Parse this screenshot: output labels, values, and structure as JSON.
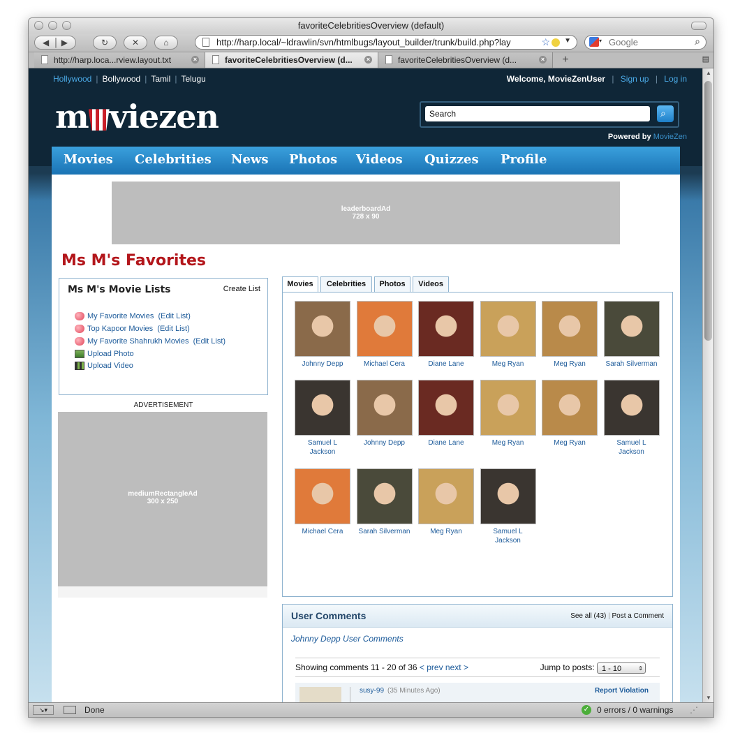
{
  "browser": {
    "title": "favoriteCelebritiesOverview (default)",
    "url": "http://harp.local/~ldrawlin/svn/htmlbugs/layout_builder/trunk/build.php?lay",
    "search_placeholder": "Google",
    "tabs": [
      {
        "label": "http://harp.loca...rview.layout.txt"
      },
      {
        "label": "favoriteCelebritiesOverview (d..."
      },
      {
        "label": "favoriteCelebritiesOverview (d..."
      }
    ],
    "status": "Done",
    "errors": "0 errors / 0 warnings"
  },
  "site": {
    "languages": [
      "Hollywood",
      "Bollywood",
      "Tamil",
      "Telugu"
    ],
    "welcome": "Welcome, MovieZenUser",
    "signup": "Sign up",
    "login": "Log in",
    "logo_left": "m",
    "logo_right": "viezen",
    "search_value": "Search",
    "powered_by": "Powered by",
    "powered_brand": "MovieZen",
    "nav": [
      "Movies",
      "Celebrities",
      "News",
      "Photos",
      "Videos",
      "Quizzes",
      "Profile"
    ]
  },
  "ads": {
    "leaderboard_name": "leaderboardAd",
    "leaderboard_size": "728 x 90",
    "advert_label": "ADVERTISEMENT",
    "medium_name": "mediumRectangleAd",
    "medium_size": "300 x 250"
  },
  "page": {
    "title": "Ms M's Favorites",
    "lists_heading": "Ms M's Movie Lists",
    "create_list": "Create List",
    "lists": [
      {
        "name": "My Favorite Movies",
        "edit": "(Edit List)"
      },
      {
        "name": "Top Kapoor Movies",
        "edit": "(Edit List)"
      },
      {
        "name": "My Favorite Shahrukh Movies",
        "edit": "(Edit List)"
      }
    ],
    "upload_photo": "Upload Photo",
    "upload_video": "Upload Video",
    "tabs": [
      "Movies",
      "Celebrities",
      "Photos",
      "Videos"
    ],
    "celebrities": [
      {
        "name": "Johnny Depp",
        "color": "#8a6a4a"
      },
      {
        "name": "Michael Cera",
        "color": "#e07a3a"
      },
      {
        "name": "Diane Lane",
        "color": "#6a2a22"
      },
      {
        "name": "Meg Ryan",
        "color": "#c9a15a"
      },
      {
        "name": "Meg Ryan",
        "color": "#b98a4a"
      },
      {
        "name": "Sarah Silverman",
        "color": "#4a4a3a"
      },
      {
        "name": "Samuel L Jackson",
        "color": "#3a3530"
      },
      {
        "name": "Johnny Depp",
        "color": "#8a6a4a"
      },
      {
        "name": "Diane Lane",
        "color": "#6a2a22"
      },
      {
        "name": "Meg Ryan",
        "color": "#c9a15a"
      },
      {
        "name": "Meg Ryan",
        "color": "#b98a4a"
      },
      {
        "name": "Samuel L Jackson",
        "color": "#3a3530"
      },
      {
        "name": "Michael Cera",
        "color": "#e07a3a"
      },
      {
        "name": "Sarah Silverman",
        "color": "#4a4a3a"
      },
      {
        "name": "Meg Ryan",
        "color": "#c9a15a"
      },
      {
        "name": "Samuel L Jackson",
        "color": "#3a3530"
      }
    ],
    "comments": {
      "title": "User Comments",
      "see_all": "See all (43)",
      "post": "Post a Comment",
      "subtitle": "Johnny Depp User Comments",
      "showing": "Showing comments 11 - 20 of 36",
      "prev": "< prev",
      "next": "next >",
      "jump_label": "Jump to posts:",
      "jump_value": "1 - 10",
      "first_user": "susy-99",
      "first_time": "(35 Minutes Ago)",
      "report": "Report Violation"
    }
  }
}
